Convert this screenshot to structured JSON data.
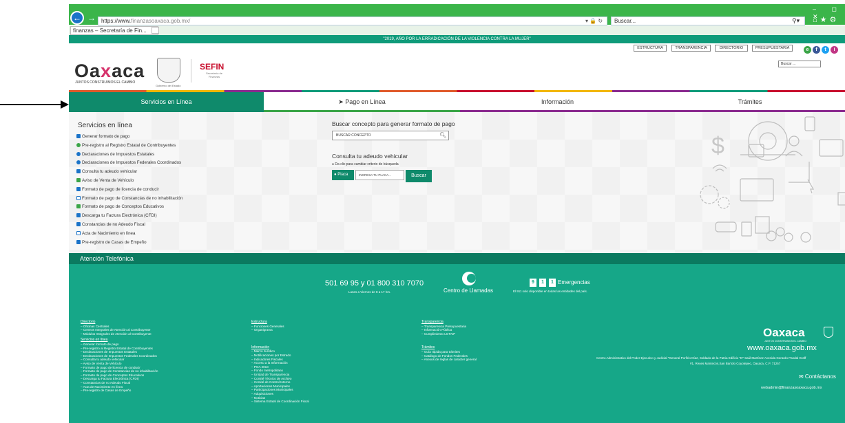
{
  "browser": {
    "url_host": "https://www.",
    "url_rest": "finanzasoaxaca.gob.mx/",
    "search_placeholder": "Buscar...",
    "tab_title": "finanzas – Secretaría de Fin...",
    "win_controls": "– ◻ ✕",
    "addr_icons": "▾ 🔒 ↻"
  },
  "slogan": "\"2019, AÑO POR LA ERRADICACIÓN DE LA VIOLENCIA CONTRA LA MUJER\"",
  "header": {
    "logo_prefix": "Oa",
    "logo_x": "x",
    "logo_suffix": "aca",
    "tagline": "JUNTOS CONSTRUIMOS EL CAMBIO",
    "shield_caption": "Gobierno del Estado",
    "sefin": "SEFIN",
    "sefin_sub": "Secretaría de Finanzas",
    "top_links": [
      "ESTRUCTURA",
      "TRANSPARENCIA",
      "DIRECTORIO",
      "PRESUPUESTARIA"
    ],
    "social": [
      "e",
      "f",
      "t",
      "i"
    ],
    "site_search": "Buscar ..."
  },
  "nav": {
    "servicios": "Servicios en Línea",
    "pago": "➤  Pago en Línea",
    "informacion": "Información",
    "tramites": "Trámites"
  },
  "services": {
    "title": "Servicios en línea",
    "items": [
      "Generar formato de pago",
      "Pre-registro al Registro Estatal de Contribuyentes",
      "Declaraciones de Impuestos Estatales",
      "Declaraciones de Impuestos Federales Coordinados",
      "Consulta tu adeudo vehicular",
      "Aviso de Venta de Vehículo",
      "Formato de pago de licencia de conducir",
      "Formato de pago de Constancias de no inhabilitación",
      "Formato de pago de Conceptos Educativos",
      "Descarga tu Factura Electrónica (CFDI)",
      "Constancias de no Adeudo Fiscal",
      "Acta de Nacimiento en línea",
      "Pre-registro de Casas de Empeño"
    ]
  },
  "search": {
    "title": "Buscar concepto para generar formato de pago",
    "placeholder": "BUSCAR CONCEPTO"
  },
  "vehicle": {
    "title": "Consulta tu adeudo vehicular",
    "hint": "● Da clic para cambiar criterio de búsqueda",
    "placa": "● Placa",
    "placa_placeholder": "INGRESA TU PLACA...",
    "buscar": "Buscar"
  },
  "phone": {
    "bar": "Atención Telefónica",
    "number": "501 69 95 y 01 800 310 7070",
    "hours": "Lunes a Viernes de 8 a 17 hrs.",
    "centro": "Centro de Llamadas",
    "digits": [
      "9",
      "1",
      "1"
    ],
    "emergencias": "Emergencias",
    "emerg_note": "El 911 solo disponible en todas las entidades del país."
  },
  "footer": {
    "col1": {
      "h1": "Directorio",
      "items1": [
        "Oficinas Centrales",
        "Centros Integrales de Atención al Contribuyente",
        "Módulos Integrales de Atención al Contribuyente"
      ],
      "h2": "Servicios en línea",
      "items2": [
        "Generar formato de pago",
        "Pre-registro al Registro Estatal de Contribuyentes",
        "Declaraciones de Impuestos Estatales",
        "Declaraciones de Impuestos Federales Coordinados",
        "Consulta tu adeudo vehicular",
        "Aviso de Venta de Vehículo",
        "Formato de pago de licencia de conducir",
        "Formato de pago de Constancias de no inhabilitación",
        "Formato de pago de Conceptos Educativos",
        "Descarga tu Factura Electrónica (CFDI)",
        "Constancias de no Adeudo Fiscal",
        "Acta de Nacimiento en línea",
        "Pre-registro de Casas de Empeño"
      ]
    },
    "col2": {
      "h1": "Estructura",
      "items1": [
        "Funciones Generales",
        "Organigrama"
      ],
      "h2": "Información",
      "items2": [
        "Marco Jurídico",
        "Notificaciones por Estrado",
        "Indicadores Fiscales",
        "Acceso a la Información",
        "POA 2018",
        "Fondo metropolitano",
        "Unidad de Transparencia",
        "Comité Técnico de Archivo",
        "Comité de Control Interno",
        "Aportaciones Municipales",
        "Participaciones Municipales",
        "Adquisiciones",
        "Noticias",
        "Sistema Estatal de Coordinación Fiscal"
      ]
    },
    "col3": {
      "h1": "Transparencia",
      "items1": [
        "Transparencia Presupuestaria",
        "Información Pública",
        "Cumplimiento LGTAIP"
      ],
      "h2": "Trámites",
      "items2": [
        "Guía rápida para trámites",
        "Catálogo de Fondos Federales",
        "Anexos de reglas de carácter general"
      ]
    },
    "logo_prefix": "Oa",
    "logo_x": "x",
    "logo_suffix": "aca",
    "tagline": "JUNTOS CONSTRUIMOS EL CAMBIO",
    "url": "www.oaxaca.gob.mx",
    "address1": "Centro Administrativo del Poder Ejecutivo y Judicial \"General Porfirio Díaz, Soldado de la Patria Edificio \"D\" Saúl Martínez Avenida Gerardo Pandal Graff",
    "address2": "#1, Reyes Mantecón,San Bartolo Coyotepec, Oaxaca, C.P. 71257",
    "contact": "✉ Contáctanos",
    "email": "webadmin@finanzasoaxaca.gob.mx"
  }
}
